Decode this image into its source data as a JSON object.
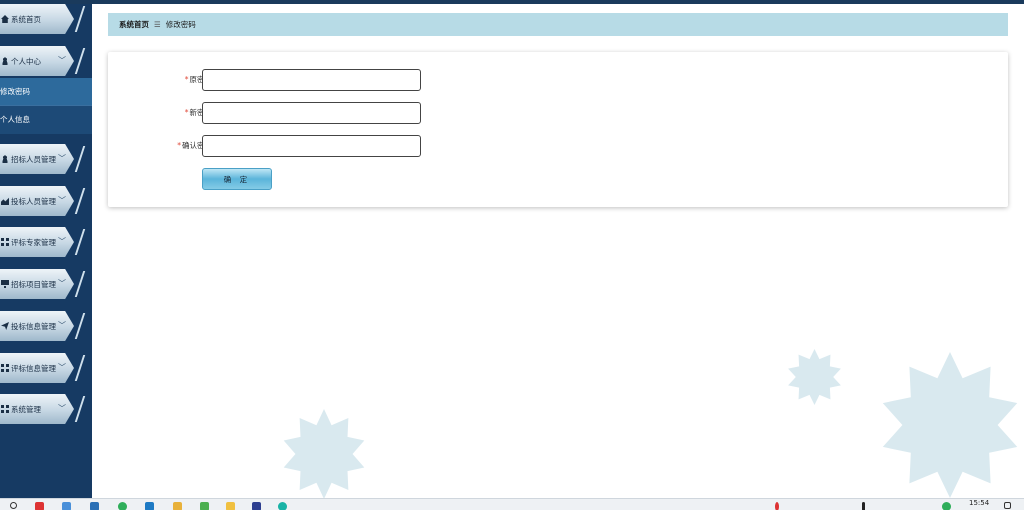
{
  "breadcrumb": {
    "home": "系统首页",
    "separator": "☰",
    "current": "修改密码"
  },
  "sidebar": {
    "items": [
      {
        "label": "系统首页",
        "icon": "home-icon",
        "has_chevron": false
      },
      {
        "label": "个人中心",
        "icon": "user-icon",
        "has_chevron": true
      },
      {
        "label": "招标人员管理",
        "icon": "user-icon",
        "has_chevron": true
      },
      {
        "label": "投标人员管理",
        "icon": "chart-icon",
        "has_chevron": true
      },
      {
        "label": "评标专家管理",
        "icon": "grid-icon",
        "has_chevron": true
      },
      {
        "label": "招标项目管理",
        "icon": "monitor-icon",
        "has_chevron": true
      },
      {
        "label": "投标信息管理",
        "icon": "send-icon",
        "has_chevron": true
      },
      {
        "label": "评标信息管理",
        "icon": "grid-icon",
        "has_chevron": true
      },
      {
        "label": "系统管理",
        "icon": "grid-icon",
        "has_chevron": true
      }
    ],
    "submenu": [
      {
        "label": "修改密码",
        "active": true
      },
      {
        "label": "个人信息",
        "active": false
      }
    ]
  },
  "form": {
    "required_mark": "*",
    "fields": [
      {
        "label": "原密码",
        "value": ""
      },
      {
        "label": "新密码",
        "value": ""
      },
      {
        "label": "确认密码",
        "value": ""
      }
    ],
    "submit_label": "确 定"
  },
  "taskbar": {
    "clock": "15:54"
  },
  "colors": {
    "sidebar_bg": "#163a63",
    "breadcrumb_bg": "#b7dbe6",
    "button": "#5bb5da",
    "required": "#e04a3a"
  }
}
